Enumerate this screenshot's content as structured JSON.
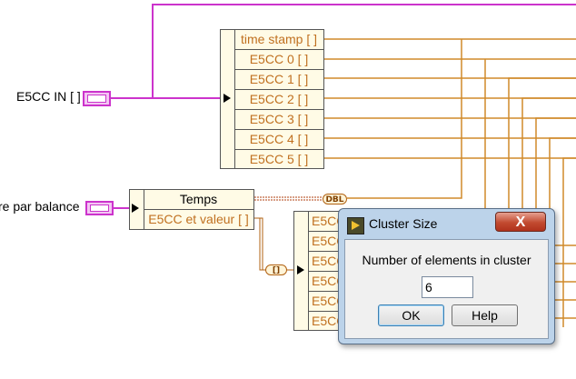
{
  "labels": {
    "e5cc_in": "E5CC IN [ ]",
    "par_balance": "re par balance"
  },
  "unbundle_top": {
    "rows": [
      "time stamp [ ]",
      "E5CC 0 [ ]",
      "E5CC 1 [ ]",
      "E5CC 2 [ ]",
      "E5CC 3 [ ]",
      "E5CC 4 [ ]",
      "E5CC 5 [ ]"
    ]
  },
  "unbundle_mid": {
    "rows": [
      "Temps",
      "E5CC et valeur [ ]"
    ]
  },
  "unbundle_bottom": {
    "rows": [
      "E5CC",
      "E5CC",
      "E5CC",
      "E5CC",
      "E5CC",
      "E5CC"
    ]
  },
  "tags": {
    "dbl": "DBL",
    "array": "[]"
  },
  "dialog": {
    "title": "Cluster Size",
    "close_label": "X",
    "prompt": "Number of elements in cluster",
    "value": "6",
    "ok_label": "OK",
    "help_label": "Help"
  },
  "colors": {
    "cluster_wire": "#cc33cc",
    "data_wire": "#d08a2a",
    "dialog_frame": "#bcd3ea"
  }
}
